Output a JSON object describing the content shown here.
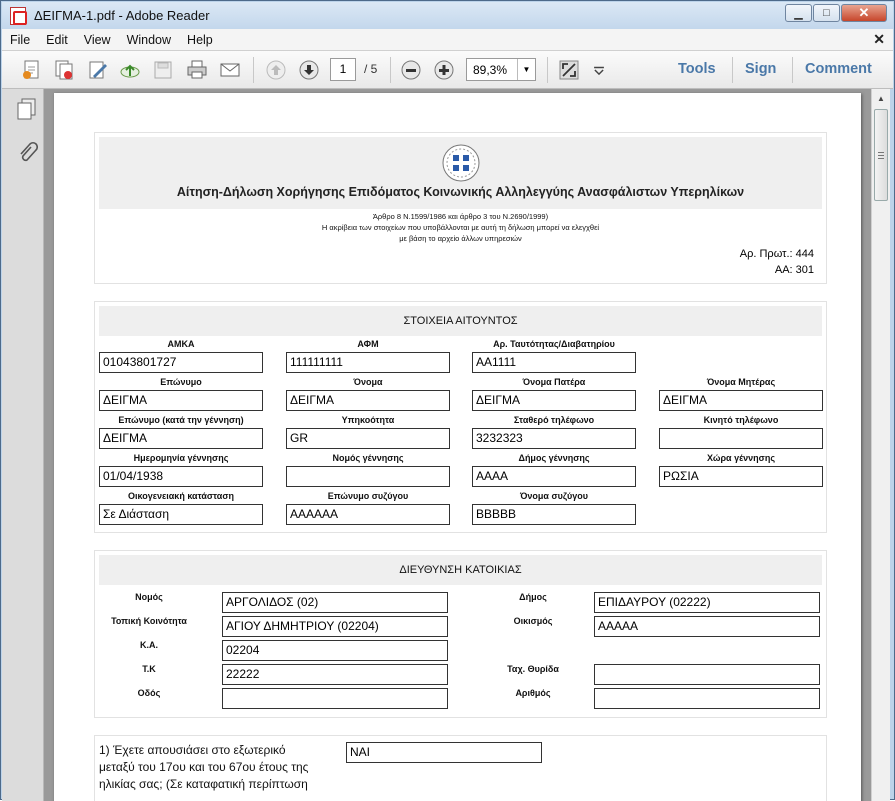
{
  "window": {
    "title": "ΔΕΙΓΜΑ-1.pdf - Adobe Reader"
  },
  "menu": [
    "File",
    "Edit",
    "View",
    "Window",
    "Help"
  ],
  "toolbar": {
    "page_current": "1",
    "page_total": "/ 5",
    "zoom": "89,3%",
    "tools_label": "Tools",
    "sign_label": "Sign",
    "comment_label": "Comment"
  },
  "doc": {
    "title": "Αίτηση-Δήλωση Χορήγησης Επιδόματος Κοινωνικής Αλληλεγγύης Ανασφάλιστων Υπερηλίκων",
    "law": "Άρθρο 8 Ν.1599/1986 και άρθρο 3 του Ν.2690/1999)",
    "note1": "Η ακρίβεια των στοιχείων που υποβάλλονται με αυτή τη δήλωση μπορεί να ελεγχθεί",
    "note2": "με βάση το αρχείο άλλων υπηρεσιών",
    "prot": "Αρ. Πρωτ.: 444",
    "aa": "ΑΑ: 301",
    "applicant": {
      "heading": "ΣΤΟΙΧΕΙΑ ΑΙΤΟΥΝΤΟΣ",
      "amka_label": "ΑΜΚΑ",
      "amka": "01043801727",
      "afm_label": "ΑΦΜ",
      "afm": "111111111",
      "id_label": "Αρ. Ταυτότητας/Διαβατηρίου",
      "id": "ΑΑ1111",
      "surname_label": "Επώνυμο",
      "surname": "ΔΕΙΓΜΑ",
      "name_label": "Όνομα",
      "name": "ΔΕΙΓΜΑ",
      "father_label": "Όνομα Πατέρα",
      "father": "ΔΕΙΓΜΑ",
      "mother_label": "Όνομα Μητέρας",
      "mother": "ΔΕΙΓΜΑ",
      "birth_surname_label": "Επώνυμο (κατά την γέννηση)",
      "birth_surname": "ΔΕΙΓΜΑ",
      "citizenship_label": "Υπηκοότητα",
      "citizenship": "GR",
      "phone_label": "Σταθερό τηλέφωνο",
      "phone": "3232323",
      "mobile_label": "Κινητό τηλέφωνο",
      "mobile": "",
      "dob_label": "Ημερομηνία γέννησης",
      "dob": "01/04/1938",
      "birth_prefecture_label": "Νομός γέννησης",
      "birth_prefecture": "",
      "birth_municipality_label": "Δήμος γέννησης",
      "birth_municipality": "ΑΑΑΑ",
      "birth_country_label": "Χώρα γέννησης",
      "birth_country": "ΡΩΣΙΑ",
      "marital_label": "Οικογενειακή κατάσταση",
      "marital": "Σε Διάσταση",
      "spouse_surname_label": "Επώνυμο συζύγου",
      "spouse_surname": "ΑΑΑΑΑΑ",
      "spouse_name_label": "Όνομα συζύγου",
      "spouse_name": "ΒΒΒΒΒ"
    },
    "address": {
      "heading": "ΔΙΕΥΘΥΝΣΗ ΚΑΤΟΙΚΙΑΣ",
      "prefecture_label": "Νομός",
      "prefecture": "ΑΡΓΟΛΙΔΟΣ (02)",
      "municipality_label": "Δήμος",
      "municipality": "ΕΠΙΔΑΥΡΟΥ (02222)",
      "community_label": "Τοπική Κοινότητα",
      "community": "ΑΓΙΟΥ ΔΗΜΗΤΡΙΟΥ (02204)",
      "settlement_label": "Οικισμός",
      "settlement": "ΑΑΑΑΑ",
      "ka_label": "Κ.Α.",
      "ka": "02204",
      "tk_label": "Τ.Κ",
      "tk": "22222",
      "pobox_label": "Ταχ. Θυρίδα",
      "pobox": "",
      "street_label": "Οδός",
      "street": "",
      "number_label": "Αριθμός",
      "number": ""
    },
    "q1": {
      "line1": "1) Έχετε απουσιάσει στο εξωτερικό",
      "line2": "μεταξύ του 17ου και του 67ου έτους της",
      "line3": "ηλικίας σας; (Σε καταφατική περίπτωση",
      "answer": "ΝΑΙ"
    }
  },
  "colors": {
    "link_blue": "#4a78a8",
    "window_frame": "#bcd3ea"
  }
}
